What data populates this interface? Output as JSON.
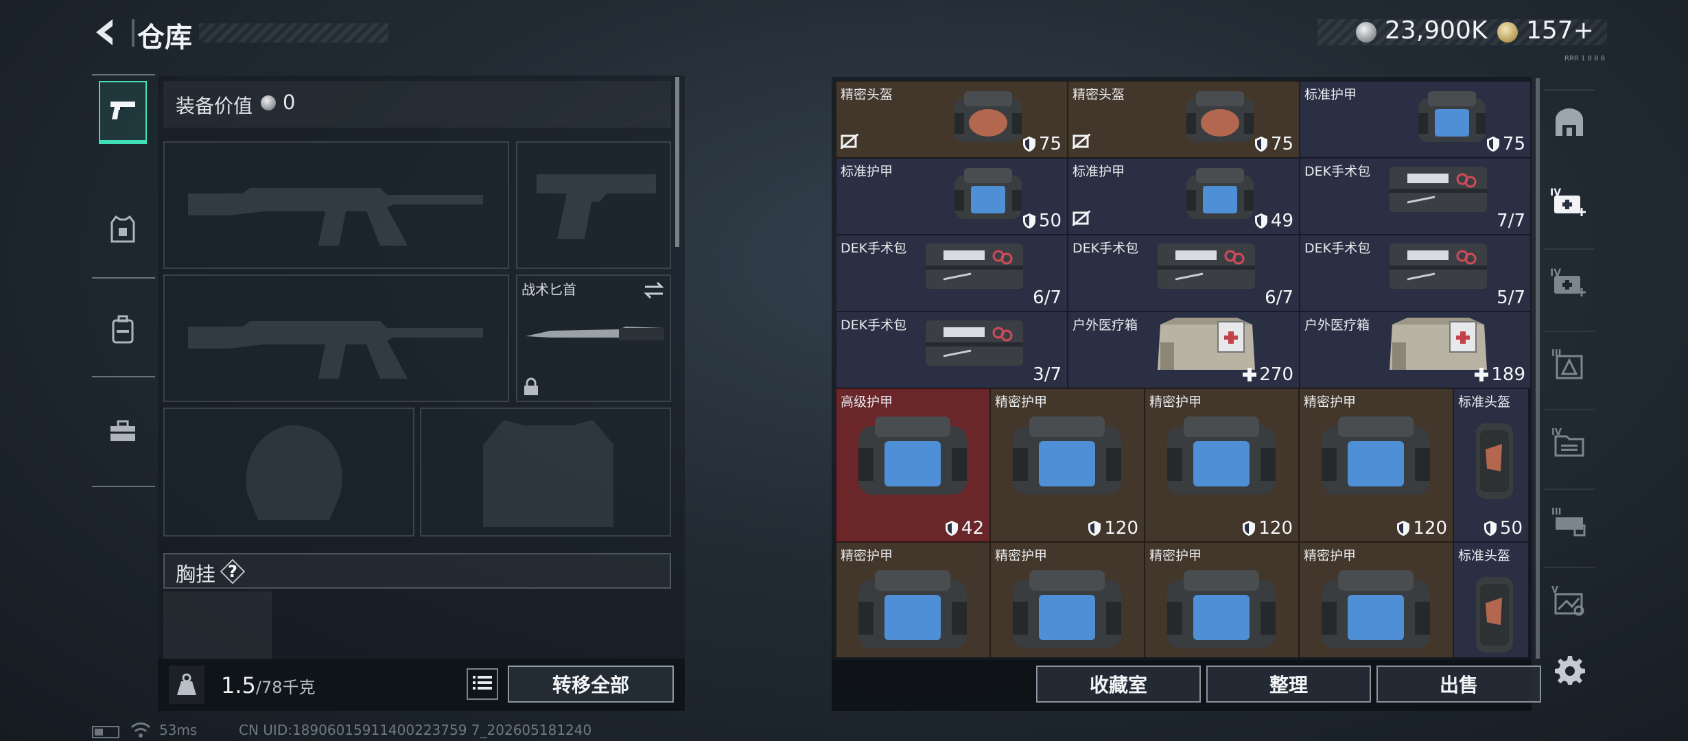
{
  "header": {
    "title": "仓库",
    "currency_silver": "23,900K",
    "currency_gold": "157+",
    "sub_text": "RRR 1 8 8 8"
  },
  "left_tabs": [
    {
      "name": "weapons",
      "icon": "pistol-icon",
      "active": true
    },
    {
      "name": "armor",
      "icon": "armor-vest-icon",
      "active": false
    },
    {
      "name": "backpack",
      "icon": "backpack-icon",
      "active": false
    },
    {
      "name": "toolbox",
      "icon": "toolbox-icon",
      "active": false
    }
  ],
  "loadout": {
    "title": "装备价值",
    "value": "0",
    "knife_slot": {
      "name": "战术匕首"
    },
    "chest_rig_label": "胸挂",
    "chest_help": "?",
    "weight_current": "1.5",
    "weight_max": "/78千克",
    "transfer_all": "转移全部"
  },
  "storage": {
    "items": [
      {
        "name": "精密头盔",
        "value": "75",
        "kind": "helmet",
        "bg": "brown",
        "badge": true,
        "icon": "shield"
      },
      {
        "name": "精密头盔",
        "value": "75",
        "kind": "helmet",
        "bg": "brown",
        "badge": true,
        "icon": "shield"
      },
      {
        "name": "标准护甲",
        "value": "75",
        "kind": "armor",
        "bg": "blue",
        "badge": false,
        "icon": "shield"
      },
      {
        "name": "标准护甲",
        "value": "50",
        "kind": "armor",
        "bg": "blue",
        "badge": false,
        "icon": "shield"
      },
      {
        "name": "标准护甲",
        "value": "49",
        "kind": "armor",
        "bg": "blue",
        "badge": true,
        "icon": "shield"
      },
      {
        "name": "DEK手术包",
        "value": "7/7",
        "kind": "kit",
        "bg": "blue",
        "badge": false,
        "icon": ""
      },
      {
        "name": "DEK手术包",
        "value": "6/7",
        "kind": "kit",
        "bg": "blue",
        "badge": false,
        "icon": ""
      },
      {
        "name": "DEK手术包",
        "value": "6/7",
        "kind": "kit",
        "bg": "blue",
        "badge": false,
        "icon": ""
      },
      {
        "name": "DEK手术包",
        "value": "5/7",
        "kind": "kit",
        "bg": "blue",
        "badge": false,
        "icon": ""
      },
      {
        "name": "DEK手术包",
        "value": "3/7",
        "kind": "kit",
        "bg": "blue",
        "badge": false,
        "icon": ""
      },
      {
        "name": "户外医疗箱",
        "value": "270",
        "kind": "medbox",
        "bg": "blue",
        "badge": false,
        "icon": "plus"
      },
      {
        "name": "户外医疗箱",
        "value": "189",
        "kind": "medbox",
        "bg": "blue",
        "badge": false,
        "icon": "plus"
      },
      {
        "name": "高级护甲",
        "value": "42",
        "kind": "bigarmor",
        "bg": "red",
        "badge": false,
        "icon": "shield"
      },
      {
        "name": "精密护甲",
        "value": "120",
        "kind": "bigarmor",
        "bg": "brown",
        "badge": false,
        "icon": "shield"
      },
      {
        "name": "精密护甲",
        "value": "120",
        "kind": "bigarmor",
        "bg": "brown",
        "badge": false,
        "icon": "shield"
      },
      {
        "name": "精密护甲",
        "value": "120",
        "kind": "bigarmor",
        "bg": "brown",
        "badge": false,
        "icon": "shield"
      },
      {
        "name": "标准头盔",
        "value": "50",
        "kind": "tallhelmet",
        "bg": "blue",
        "badge": false,
        "icon": "shield"
      },
      {
        "name": "精密护甲",
        "value": "",
        "kind": "bigarmor",
        "bg": "brown",
        "badge": false,
        "icon": ""
      },
      {
        "name": "精密护甲",
        "value": "",
        "kind": "bigarmor",
        "bg": "brown",
        "badge": false,
        "icon": ""
      },
      {
        "name": "精密护甲",
        "value": "",
        "kind": "bigarmor",
        "bg": "brown",
        "badge": false,
        "icon": ""
      },
      {
        "name": "精密护甲",
        "value": "",
        "kind": "bigarmor",
        "bg": "brown",
        "badge": false,
        "icon": ""
      },
      {
        "name": "标准头盔",
        "value": "",
        "kind": "tallhelmet",
        "bg": "blue",
        "badge": false,
        "icon": ""
      }
    ],
    "buttons": {
      "collection": "收藏室",
      "organize": "整理",
      "sell": "出售"
    }
  },
  "right_nav": [
    {
      "name": "vault",
      "icon": "vault-icon"
    },
    {
      "name": "med-iv",
      "icon": "medkit-iv-icon"
    },
    {
      "name": "med-iv-2",
      "icon": "medkit-iv-alt-icon"
    },
    {
      "name": "armor-iii",
      "icon": "armor-iii-icon"
    },
    {
      "name": "folder-iv",
      "icon": "folder-iv-icon"
    },
    {
      "name": "rig-iii",
      "icon": "rig-iii-icon"
    },
    {
      "name": "map-v",
      "icon": "map-v-icon"
    }
  ],
  "status": {
    "ping": "53ms",
    "uid": "CN UID:18906015911400223759 7_202605181240"
  },
  "colors": {
    "accent": "#3fe0b7",
    "cell_brown": "#43362a",
    "cell_blue": "#2b2f44",
    "cell_red": "#6a2628"
  }
}
